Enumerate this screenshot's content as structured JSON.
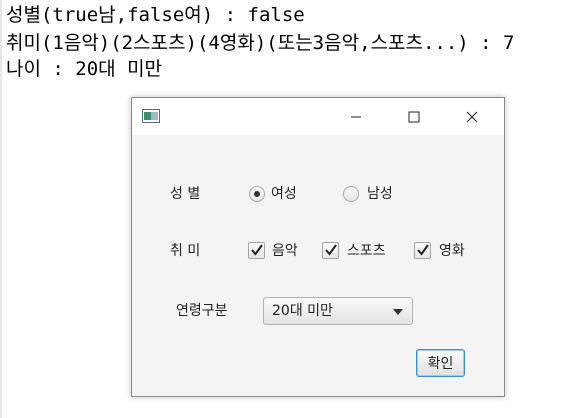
{
  "console": {
    "line1": "성별(true남,false여) : false",
    "line2": "취미(1음악)(2스포츠)(4영화)(또는3음악,스포츠...) : 7",
    "line3": "나이 : 20대 미만"
  },
  "window": {
    "gender_label": "성 별",
    "gender_options": [
      "여성",
      "남성"
    ],
    "gender_selected": "여성",
    "hobby_label": "취 미",
    "hobbies": [
      {
        "label": "음악",
        "checked": true
      },
      {
        "label": "스포츠",
        "checked": true
      },
      {
        "label": "영화",
        "checked": true
      }
    ],
    "age_label": "연령구분",
    "age_selected": "20대 미만",
    "confirm_label": "확인"
  },
  "icons": [
    "app-icon",
    "minimize-icon",
    "maximize-icon",
    "close-icon",
    "chevron-down-icon",
    "checkmark-icon"
  ]
}
